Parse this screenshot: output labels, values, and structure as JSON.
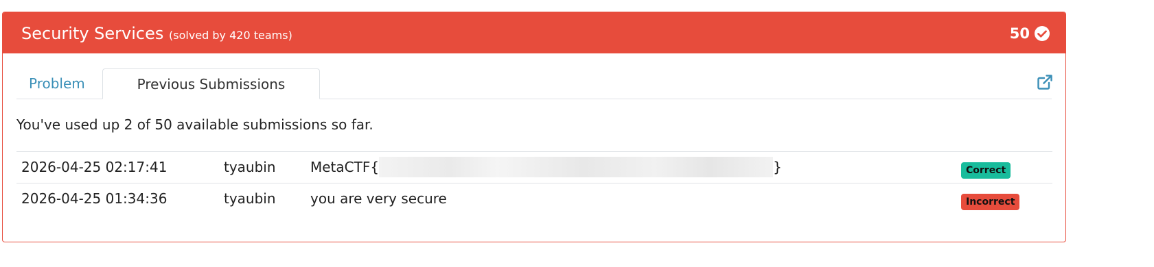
{
  "challenge": {
    "title": "Security Services",
    "solved_note": "(solved by 420 teams)",
    "points": "50",
    "check_icon": "check-circle-icon"
  },
  "tabs": [
    {
      "label": "Problem",
      "active": false
    },
    {
      "label": "Previous Submissions",
      "active": true
    }
  ],
  "external_link_icon": "external-link-icon",
  "submissions_info": "You've used up 2 of 50 available submissions so far.",
  "submissions": [
    {
      "time": "2026-04-25 02:17:41",
      "user": "tyaubin",
      "flag_prefix": "MetaCTF{",
      "flag_suffix": "}",
      "redacted": true,
      "status": "Correct"
    },
    {
      "time": "2026-04-25 01:34:36",
      "user": "tyaubin",
      "flag_text": "you are very secure",
      "redacted": false,
      "status": "Incorrect"
    }
  ],
  "colors": {
    "header_bg": "#e74c3c",
    "tab_link": "#3a8fb7",
    "correct_badge": "#18bc9c",
    "incorrect_badge": "#e74c3c"
  }
}
